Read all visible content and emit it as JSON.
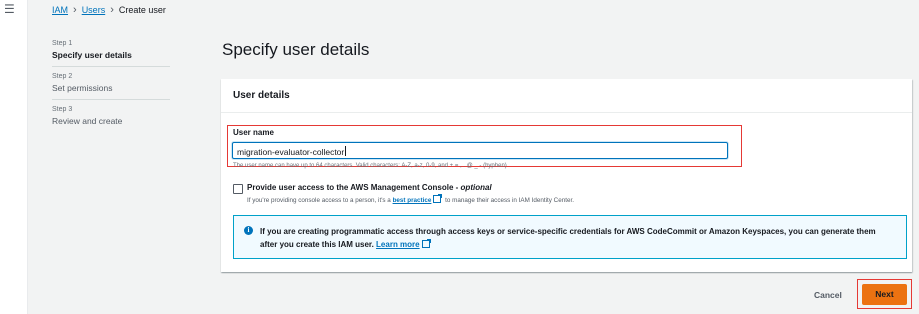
{
  "nav": {
    "menu_icon": "hamburger-menu-icon"
  },
  "breadcrumb": {
    "items": [
      "IAM",
      "Users",
      "Create user"
    ]
  },
  "steps": [
    {
      "number": "Step 1",
      "label": "Specify user details"
    },
    {
      "number": "Step 2",
      "label": "Set permissions"
    },
    {
      "number": "Step 3",
      "label": "Review and create"
    }
  ],
  "page": {
    "title": "Specify user details"
  },
  "card": {
    "header": "User details",
    "user_name": {
      "label": "User name",
      "value": "migration-evaluator-collector",
      "hint": "The user name can have up to 64 characters. Valid characters: A-Z, a-z, 0-9, and + = , . @ _ - (hyphen)"
    },
    "console_access": {
      "label": "Provide user access to the AWS Management Console - ",
      "label_optional": "optional",
      "desc_before": "If you're providing console access to a person, it's a ",
      "desc_link": "best practice",
      "desc_after": " to manage their access in IAM Identity Center."
    },
    "info": {
      "text": "If you are creating programmatic access through access keys or service-specific credentials for AWS CodeCommit or Amazon Keyspaces, you can generate them after you create this IAM user. ",
      "link": "Learn more"
    }
  },
  "actions": {
    "cancel": "Cancel",
    "next": "Next"
  },
  "colors": {
    "primary": "#ec7211",
    "link": "#0073bb",
    "highlight": "#e53935"
  }
}
